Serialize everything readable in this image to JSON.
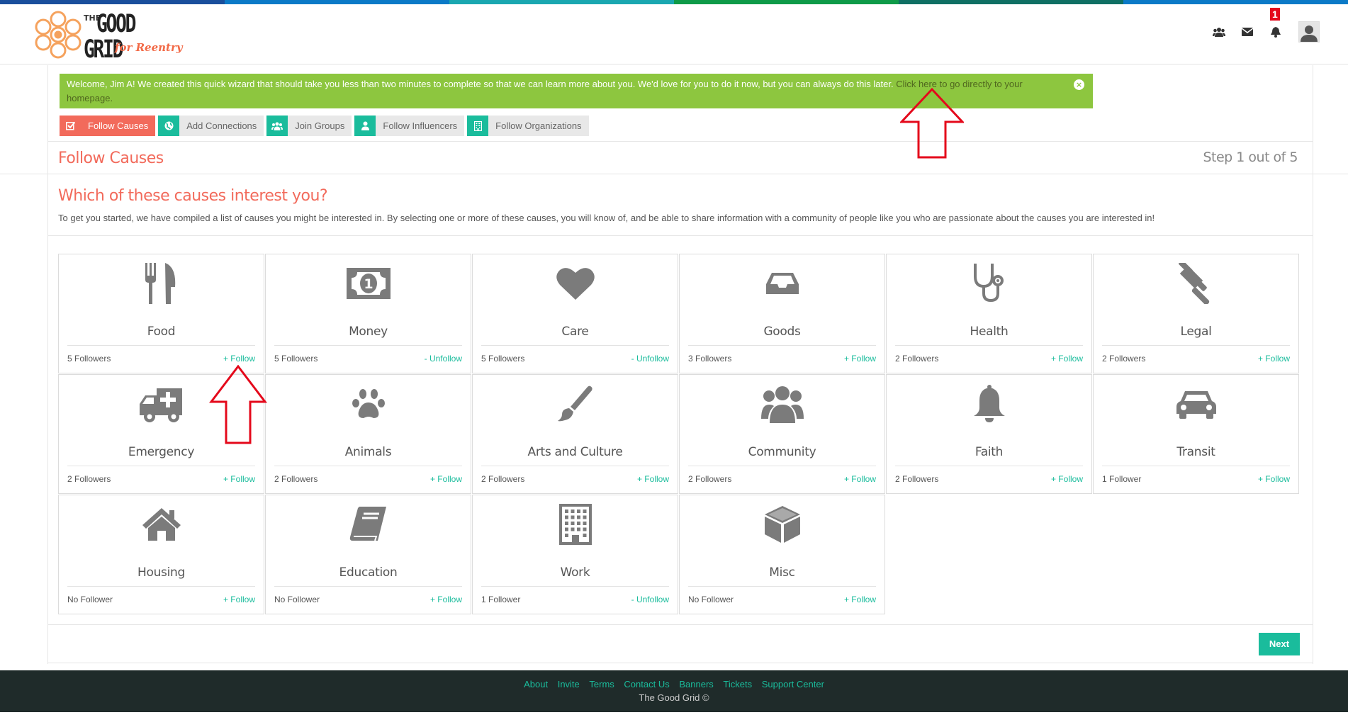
{
  "colors": {
    "accent": "#f26a5b",
    "teal": "#1abc9c",
    "alert_green": "#8dc63f",
    "icon_gray": "#7b7b7b",
    "topbar": [
      "#1a4f9c",
      "#0b7ac7",
      "#1aa7b0",
      "#0e9a48",
      "#0f6f63",
      "#0b7ac7"
    ]
  },
  "header": {
    "logo": {
      "the": "THE",
      "good": "GOOD",
      "grid": "GRID",
      "tagline": "for Reentry"
    },
    "icons": [
      "connections-icon",
      "messages-icon",
      "notifications-icon"
    ],
    "notification_count": "1"
  },
  "alert": {
    "text": "Welcome, Jim A! We created this quick wizard that should take you less than two minutes to complete so that we can learn more about you. We'd love for you to do it now, but you can always do this later.",
    "link_text": "Click here to go directly to your homepage.",
    "close": "×"
  },
  "steps": [
    {
      "label": "Follow Causes",
      "icon": "check-square-icon"
    },
    {
      "label": "Add Connections",
      "icon": "globe-icon"
    },
    {
      "label": "Join Groups",
      "icon": "group-icon"
    },
    {
      "label": "Follow Influencers",
      "icon": "user-icon"
    },
    {
      "label": "Follow Organizations",
      "icon": "building-icon"
    }
  ],
  "section": {
    "title": "Follow Causes",
    "step_count": "Step 1 out of 5",
    "question": "Which of these causes interest you?",
    "description": "To get you started, we have compiled a list of causes you might be interested in. By selecting one or more of these causes, you will know of, and be able to share information with a community of people like you who are passionate about the causes you are interested in!"
  },
  "causes": [
    {
      "name": "Food",
      "followers": "5 Followers",
      "action": "+ Follow",
      "icon": "cutlery-icon"
    },
    {
      "name": "Money",
      "followers": "5 Followers",
      "action": "- Unfollow",
      "icon": "money-icon"
    },
    {
      "name": "Care",
      "followers": "5 Followers",
      "action": "- Unfollow",
      "icon": "heart-icon"
    },
    {
      "name": "Goods",
      "followers": "3 Followers",
      "action": "+ Follow",
      "icon": "inbox-icon"
    },
    {
      "name": "Health",
      "followers": "2 Followers",
      "action": "+ Follow",
      "icon": "stethoscope-icon"
    },
    {
      "name": "Legal",
      "followers": "2 Followers",
      "action": "+ Follow",
      "icon": "gavel-icon"
    },
    {
      "name": "Emergency",
      "followers": "2 Followers",
      "action": "+ Follow",
      "icon": "ambulance-icon"
    },
    {
      "name": "Animals",
      "followers": "2 Followers",
      "action": "+ Follow",
      "icon": "paw-icon"
    },
    {
      "name": "Arts and Culture",
      "followers": "2 Followers",
      "action": "+ Follow",
      "icon": "paintbrush-icon"
    },
    {
      "name": "Community",
      "followers": "2 Followers",
      "action": "+ Follow",
      "icon": "users-icon"
    },
    {
      "name": "Faith",
      "followers": "2 Followers",
      "action": "+ Follow",
      "icon": "bell-icon"
    },
    {
      "name": "Transit",
      "followers": "1 Follower",
      "action": "+ Follow",
      "icon": "car-icon"
    },
    {
      "name": "Housing",
      "followers": "No Follower",
      "action": "+ Follow",
      "icon": "home-icon"
    },
    {
      "name": "Education",
      "followers": "No Follower",
      "action": "+ Follow",
      "icon": "book-icon"
    },
    {
      "name": "Work",
      "followers": "1 Follower",
      "action": "- Unfollow",
      "icon": "building-icon"
    },
    {
      "name": "Misc",
      "followers": "No Follower",
      "action": "+ Follow",
      "icon": "cube-icon"
    }
  ],
  "next_label": "Next",
  "footer": {
    "links": [
      "About",
      "Invite",
      "Terms",
      "Contact Us",
      "Banners",
      "Tickets",
      "Support Center"
    ],
    "copyright": "The Good Grid ©"
  }
}
